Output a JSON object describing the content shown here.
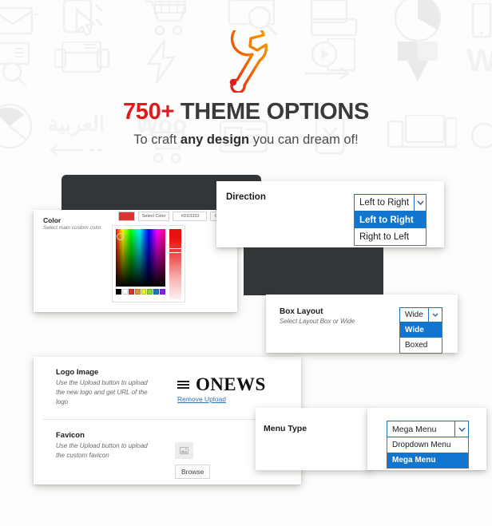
{
  "hero": {
    "wrench_icon": "wrench-icon",
    "headline_count": "750+",
    "headline_rest": " THEME OPTIONS",
    "sub_pre": "To craft ",
    "sub_bold": "any design",
    "sub_post": " you can dream of!",
    "accent_red": "#e01b1b",
    "wrench_gradient_from": "#f59a00",
    "wrench_gradient_to": "#e01b1b"
  },
  "background": {
    "icon_color": "#f0f0f0",
    "words": [
      "العربية",
      "Woo",
      "WC"
    ],
    "icons": [
      "envelope-icon",
      "cursor-click-icon",
      "shopping-cart-icon",
      "search-monitor-icon",
      "responsive-screens-icon",
      "pie-chart-icon",
      "mobile-icon",
      "list-search-icon",
      "layout-icon",
      "lightning-icon",
      "video-play-icon",
      "cube-icon",
      "satellite-icon",
      "article-icon",
      "checkbox-icon",
      "devices-icon"
    ]
  },
  "cards": {
    "color": {
      "title": "Color",
      "desc": "Select main custom color.",
      "swatch_value": "#dd3333",
      "select_color_label": "Select Color",
      "hex_value": "#DD3333",
      "clear_label": "Clear",
      "presets": [
        "#000000",
        "#ffffff",
        "#dd3333",
        "#dd9933",
        "#eeee22",
        "#81d742",
        "#1e73be",
        "#8224e3"
      ]
    },
    "direction": {
      "title": "Direction",
      "select": {
        "value": "Left to Right",
        "options": [
          "Left to Right",
          "Right to Left"
        ],
        "selected_index": 0
      }
    },
    "box_layout": {
      "title": "Box Layout",
      "desc": "Select Layout Box or Wide",
      "select": {
        "value": "Wide",
        "options": [
          "Wide",
          "Boxed"
        ],
        "selected_index": 0
      }
    },
    "logo": {
      "title": "Logo Image",
      "desc": "Use the Upload button to upload the new logo and get URL of the logo",
      "brand_text": "ONEWS",
      "remove_upload_label": "Remove Upload",
      "link_color": "#2e73b8"
    },
    "favicon": {
      "title": "Favicon",
      "desc": "Use the Upload button to upload the custom favicon",
      "browse_label": "Browse",
      "thumb_icon": "image-placeholder-icon"
    },
    "menu_type": {
      "title": "Menu Type",
      "select": {
        "value": "Mega Menu",
        "options": [
          "Dropdown Menu",
          "Mega Menu"
        ],
        "selected_index": 1
      }
    }
  },
  "theme": {
    "dark_shape_color": "#323639",
    "select_border": "#1f6fb8",
    "select_highlight": "#1176d0",
    "page_bg": "#fdfdfd"
  }
}
